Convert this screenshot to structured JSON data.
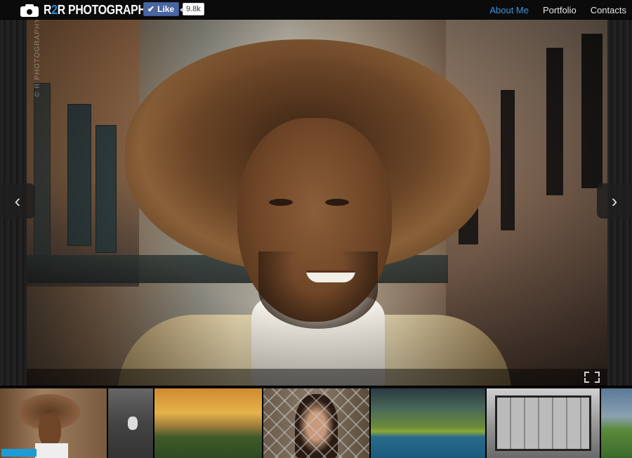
{
  "header": {
    "brand_prefix": "R",
    "brand_accent": "2",
    "brand_suffix": "R PHOTOGRAPHY",
    "like_label": "Like",
    "like_count": "9.8k"
  },
  "nav": {
    "items": [
      {
        "label": "About Me",
        "active": true
      },
      {
        "label": "Portfolio",
        "active": false
      },
      {
        "label": "Contacts",
        "active": false
      }
    ]
  },
  "slideshow": {
    "watermark": "© R PHOTOGRAPHY",
    "prev_icon": "chevron-left-icon",
    "next_icon": "chevron-right-icon",
    "fullscreen_icon": "fullscreen-icon"
  },
  "thumbnails": [
    {
      "name": "portrait-afro-man",
      "selected": true
    },
    {
      "name": "seagull-on-rocks"
    },
    {
      "name": "mountain-sunset"
    },
    {
      "name": "woman-behind-fence"
    },
    {
      "name": "lake-forest"
    },
    {
      "name": "graffiti-bw"
    },
    {
      "name": "green-hills"
    }
  ],
  "colors": {
    "accent": "#3a97e0",
    "like_button": "#4a66a0",
    "progress": "#1c9bd6"
  }
}
